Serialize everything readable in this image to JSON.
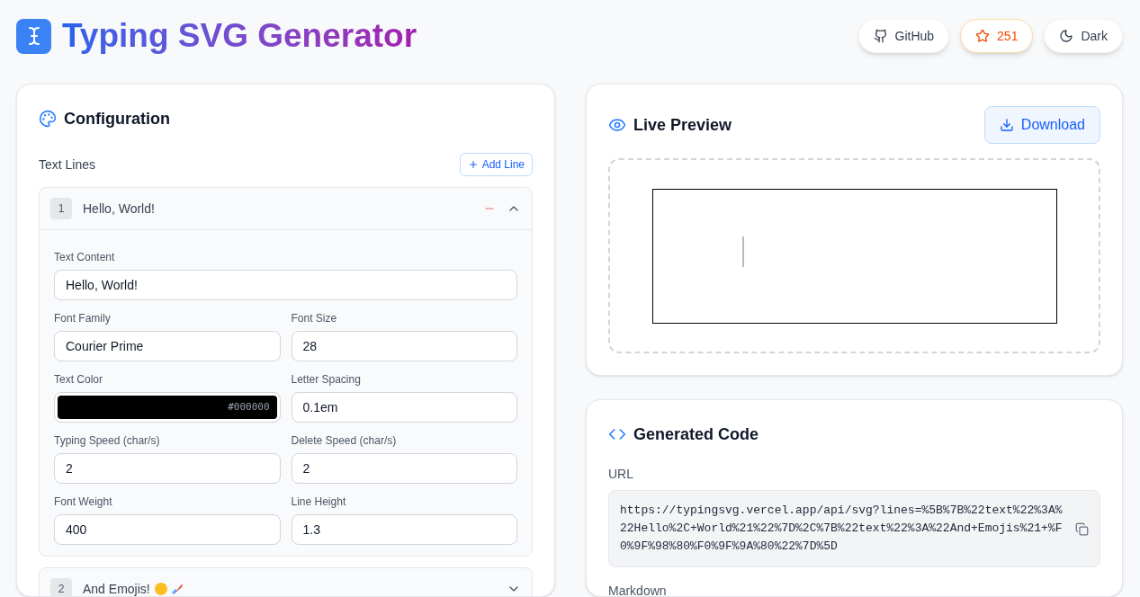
{
  "header": {
    "title": "Typing SVG Generator",
    "buttons": [
      {
        "kind": "github",
        "label": "GitHub"
      },
      {
        "kind": "star",
        "label": "251"
      },
      {
        "kind": "theme",
        "label": "Dark"
      }
    ]
  },
  "configuration": {
    "title": "Configuration",
    "section_label": "Text Lines",
    "add_button": "Add Line",
    "lines": [
      {
        "number": "1",
        "text": "Hello, World!",
        "expanded": true,
        "fields": [
          {
            "kind": "text",
            "label": "Text Content",
            "value": "Hello, World!",
            "wide": true
          },
          {
            "kind": "text",
            "label": "Font Family",
            "value": "Courier Prime"
          },
          {
            "kind": "text",
            "label": "Font Size",
            "value": "28"
          },
          {
            "kind": "color",
            "label": "Text Color",
            "value": "#000000",
            "color": "#000000"
          },
          {
            "kind": "text",
            "label": "Letter Spacing",
            "value": "0.1em"
          },
          {
            "kind": "text",
            "label": "Typing Speed (char/s)",
            "value": "2"
          },
          {
            "kind": "text",
            "label": "Delete Speed (char/s)",
            "value": "2"
          },
          {
            "kind": "text",
            "label": "Font Weight",
            "value": "400"
          },
          {
            "kind": "text",
            "label": "Line Height",
            "value": "1.3"
          }
        ]
      },
      {
        "number": "2",
        "text": "And Emojis!",
        "expanded": false
      }
    ]
  },
  "preview": {
    "title": "Live Preview",
    "download": "Download"
  },
  "code": {
    "title": "Generated Code",
    "url_label": "URL",
    "url": "https://typingsvg.vercel.app/api/svg?lines=%5B%7B%22text%22%3A%22Hello%2C+World%21%22%7D%2C%7B%22text%22%3A%22And+Emojis%21+%F0%9F%98%80%F0%9F%9A%80%22%7D%5D",
    "markdown_label": "Markdown"
  }
}
